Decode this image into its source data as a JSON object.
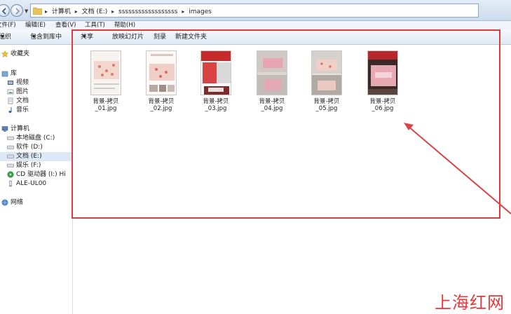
{
  "address_bar": {
    "crumbs": [
      "计算机",
      "文档 (E:)",
      "ssssssssssssssssss",
      "images"
    ]
  },
  "menu": {
    "items": [
      "文件(F)",
      "编辑(E)",
      "查看(V)",
      "工具(T)",
      "帮助(H)"
    ]
  },
  "toolbar": {
    "organize": "组织",
    "include_library": "包含到库中",
    "share": "共享",
    "slideshow": "放映幻灯片",
    "burn": "刻录",
    "new_folder": "新建文件夹"
  },
  "sidebar": {
    "favorites": "收藏夹",
    "library": "库",
    "library_items": [
      "视频",
      "图片",
      "文档",
      "音乐"
    ],
    "computer": "计算机",
    "computer_items": [
      "本地磁盘 (C:)",
      "软件 (D:)",
      "文档 (E:)",
      "娱乐 (F:)",
      "CD 驱动器 (I:) Hi",
      "ALE-UL00"
    ],
    "network": "网络"
  },
  "files": [
    {
      "line1": "背景-拷贝",
      "line2": "_01.jpg"
    },
    {
      "line1": "背景-拷贝",
      "line2": "_02.jpg"
    },
    {
      "line1": "背景-拷贝",
      "line2": "_03.jpg"
    },
    {
      "line1": "背景-拷贝",
      "line2": "_04.jpg"
    },
    {
      "line1": "背景-拷贝",
      "line2": "_05.jpg"
    },
    {
      "line1": "背景-拷贝",
      "line2": "_06.jpg"
    }
  ],
  "watermark": "上海红网",
  "colors": {
    "highlight": "#e0393e",
    "watermark": "#e8373b"
  }
}
